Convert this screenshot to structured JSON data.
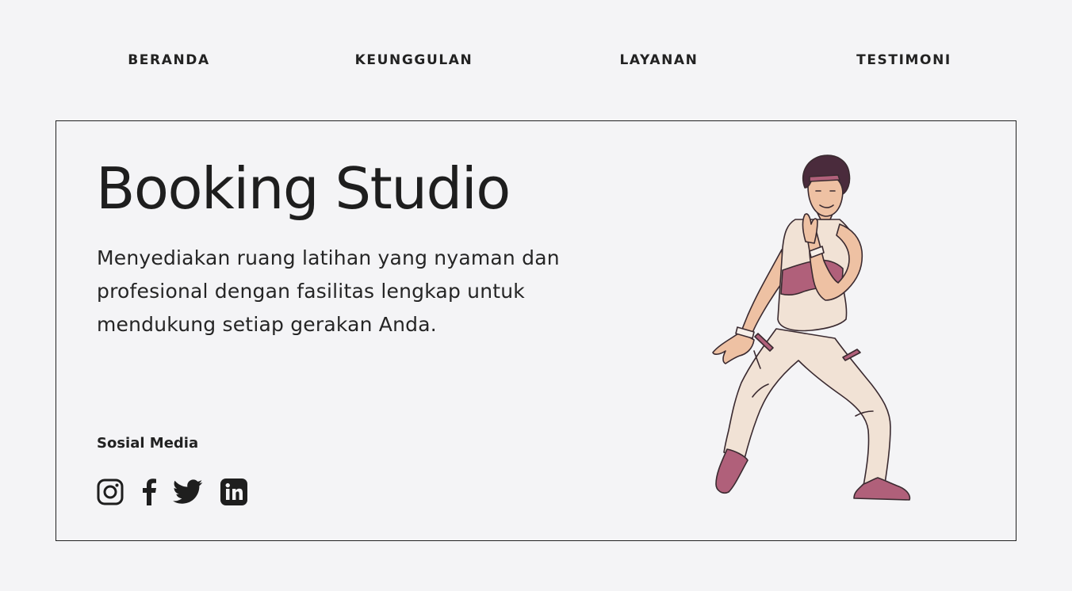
{
  "nav": {
    "items": [
      {
        "label": "BERANDA"
      },
      {
        "label": "KEUNGGULAN"
      },
      {
        "label": "LAYANAN"
      },
      {
        "label": "TESTIMONI"
      }
    ]
  },
  "hero": {
    "title": "Booking Studio",
    "description": "Menyediakan ruang latihan yang nyaman dan profesional dengan fasilitas lengkap untuk mendukung setiap gerakan Anda."
  },
  "social": {
    "title": "Sosial Media",
    "icons": [
      "instagram-icon",
      "facebook-icon",
      "twitter-icon",
      "linkedin-icon"
    ]
  },
  "colors": {
    "background": "#f4f4f6",
    "text": "#1f1f1f",
    "accent_pink": "#b0607a",
    "outfit_cream": "#f1e2d5",
    "skin": "#eec1a3",
    "hair": "#4a2b3c"
  }
}
